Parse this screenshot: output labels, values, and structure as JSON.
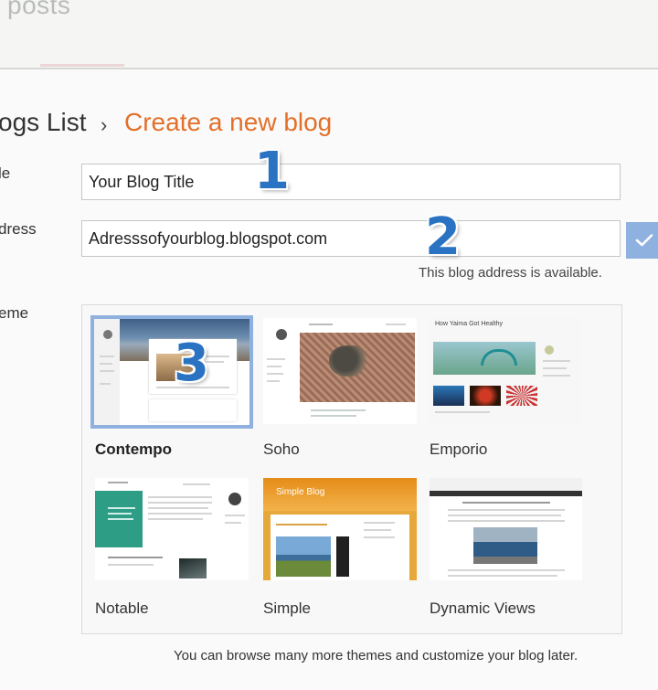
{
  "header": {
    "section_title": "posts"
  },
  "breadcrumb": {
    "parent": "ogs List",
    "separator": "›",
    "current": "Create a new blog"
  },
  "form": {
    "title_label": "le",
    "title_value": "Your Blog Title",
    "address_label": "dress",
    "address_value": "Adresssofyourblog.blogspot.com",
    "address_status": "This blog address is available.",
    "theme_label": "eme"
  },
  "annotations": [
    "1",
    "2",
    "3"
  ],
  "themes": [
    {
      "name": "Contempo",
      "selected": true
    },
    {
      "name": "Soho",
      "selected": false
    },
    {
      "name": "Emporio",
      "selected": false
    },
    {
      "name": "Notable",
      "selected": false
    },
    {
      "name": "Simple",
      "selected": false
    },
    {
      "name": "Dynamic Views",
      "selected": false
    }
  ],
  "previews": {
    "emporio_title": "How Yaima Got Healthy",
    "simple_title": "Simple Blog"
  },
  "footer": {
    "note": "You can browse many more themes and customize your blog later."
  },
  "colors": {
    "accent": "#e3702a",
    "selection": "#8fb1e0",
    "step_number": "#2a73c2"
  },
  "icons": {
    "confirm": "check-icon"
  }
}
